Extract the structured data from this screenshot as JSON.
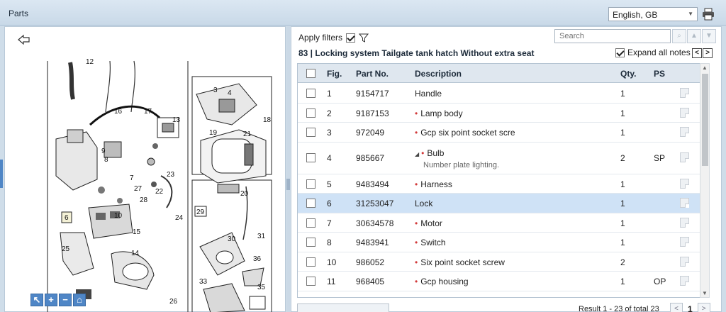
{
  "window": {
    "title": "Parts"
  },
  "language": {
    "selected": "English, GB"
  },
  "filters": {
    "apply_label": "Apply filters",
    "apply_checked": true
  },
  "search": {
    "placeholder": "Search"
  },
  "section": {
    "heading": "83 | Locking system Tailgate tank hatch Without extra seat"
  },
  "notes": {
    "expand_label": "Expand all notes",
    "expand_checked": true
  },
  "table": {
    "headers": {
      "fig": "Fig.",
      "part": "Part No.",
      "desc": "Description",
      "qty": "Qty.",
      "ps": "PS"
    },
    "rows": [
      {
        "fig": "1",
        "part": "9154717",
        "desc": "Handle",
        "bullet": false,
        "qty": "1",
        "ps": "",
        "note": "",
        "selected": false
      },
      {
        "fig": "2",
        "part": "9187153",
        "desc": "Lamp body",
        "bullet": true,
        "qty": "1",
        "ps": "",
        "note": "",
        "selected": false
      },
      {
        "fig": "3",
        "part": "972049",
        "desc": "Gcp six point socket scre",
        "bullet": true,
        "qty": "1",
        "ps": "",
        "note": "",
        "selected": false
      },
      {
        "fig": "4",
        "part": "985667",
        "desc": "Bulb",
        "bullet": true,
        "expandable": true,
        "qty": "2",
        "ps": "SP",
        "note": "Number plate lighting.",
        "selected": false
      },
      {
        "fig": "5",
        "part": "9483494",
        "desc": "Harness",
        "bullet": true,
        "qty": "1",
        "ps": "",
        "note": "",
        "selected": false
      },
      {
        "fig": "6",
        "part": "31253047",
        "desc": "Lock",
        "bullet": false,
        "qty": "1",
        "ps": "",
        "note": "",
        "selected": true
      },
      {
        "fig": "7",
        "part": "30634578",
        "desc": "Motor",
        "bullet": true,
        "qty": "1",
        "ps": "",
        "note": "",
        "selected": false
      },
      {
        "fig": "8",
        "part": "9483941",
        "desc": "Switch",
        "bullet": true,
        "qty": "1",
        "ps": "",
        "note": "",
        "selected": false
      },
      {
        "fig": "10",
        "part": "986052",
        "desc": "Six point socket screw",
        "bullet": true,
        "qty": "2",
        "ps": "",
        "note": "",
        "selected": false
      },
      {
        "fig": "11",
        "part": "968405",
        "desc": "Gcp housing",
        "bullet": true,
        "qty": "1",
        "ps": "OP",
        "note": "",
        "selected": false
      }
    ]
  },
  "pagination": {
    "result": "Result 1 - 23 of total 23",
    "page": "1"
  },
  "diagram": {
    "callouts": [
      "12",
      "16",
      "17",
      "9",
      "8",
      "7",
      "13",
      "23",
      "22",
      "27",
      "28",
      "6",
      "10",
      "24",
      "15",
      "14",
      "25",
      "26",
      "11",
      "3",
      "4",
      "18",
      "19",
      "21",
      "20",
      "29",
      "30",
      "31",
      "36",
      "33",
      "35"
    ]
  },
  "icons": {
    "printer": "printer-icon",
    "back": "back-arrow-icon",
    "filter": "filter-icon"
  },
  "colors": {
    "accent": "#4f86c6",
    "selected_row": "#cfe2f6",
    "bullet": "#d23a3a"
  }
}
